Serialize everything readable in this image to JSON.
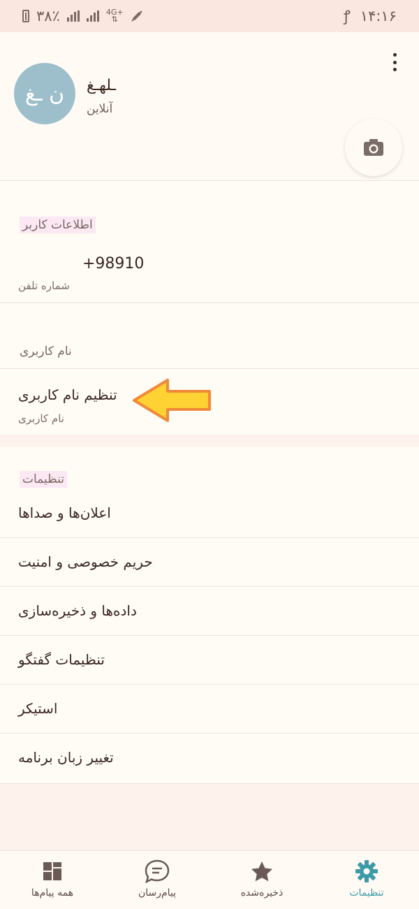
{
  "status_bar": {
    "time": "۱۴:۱۶",
    "carrier_glyph": "ꝭ",
    "battery_percent": "۳۸٪",
    "network_type": "4G+"
  },
  "profile": {
    "name": "ـلهـغ",
    "status": "آنلاین",
    "avatar_initials": "ن ـغ"
  },
  "account": {
    "section_title": "اطلاعات کاربر",
    "phone_number": "+98910",
    "phone_caption": "شماره تلفن"
  },
  "username_section": {
    "title": "نام کاربری",
    "item_primary": "تنظیم نام کاربری",
    "item_secondary": "نام کاربری"
  },
  "settings_section": {
    "title": "تنظیمات",
    "items": [
      "اعلان‌ها و صداها",
      "حریم خصوصی و امنیت",
      "داده‌ها و ذخیره‌سازی",
      "تنظیمات گفتگو",
      "استیکر",
      "تغییر زبان برنامه"
    ]
  },
  "bottom_nav": {
    "items": [
      {
        "label": "همه پیام‌ها",
        "icon": "dashboard-icon"
      },
      {
        "label": "پیام‌رسان",
        "icon": "chat-icon"
      },
      {
        "label": "ذخیره‌شده",
        "icon": "star-icon"
      },
      {
        "label": "تنظیمات",
        "icon": "gear-icon"
      }
    ],
    "active_index": 3
  },
  "colors": {
    "accent": "#3d9aa8",
    "avatar_bg": "#9dbfcb",
    "arrow_fill": "#ffd233",
    "arrow_stroke": "#f08a3a"
  }
}
